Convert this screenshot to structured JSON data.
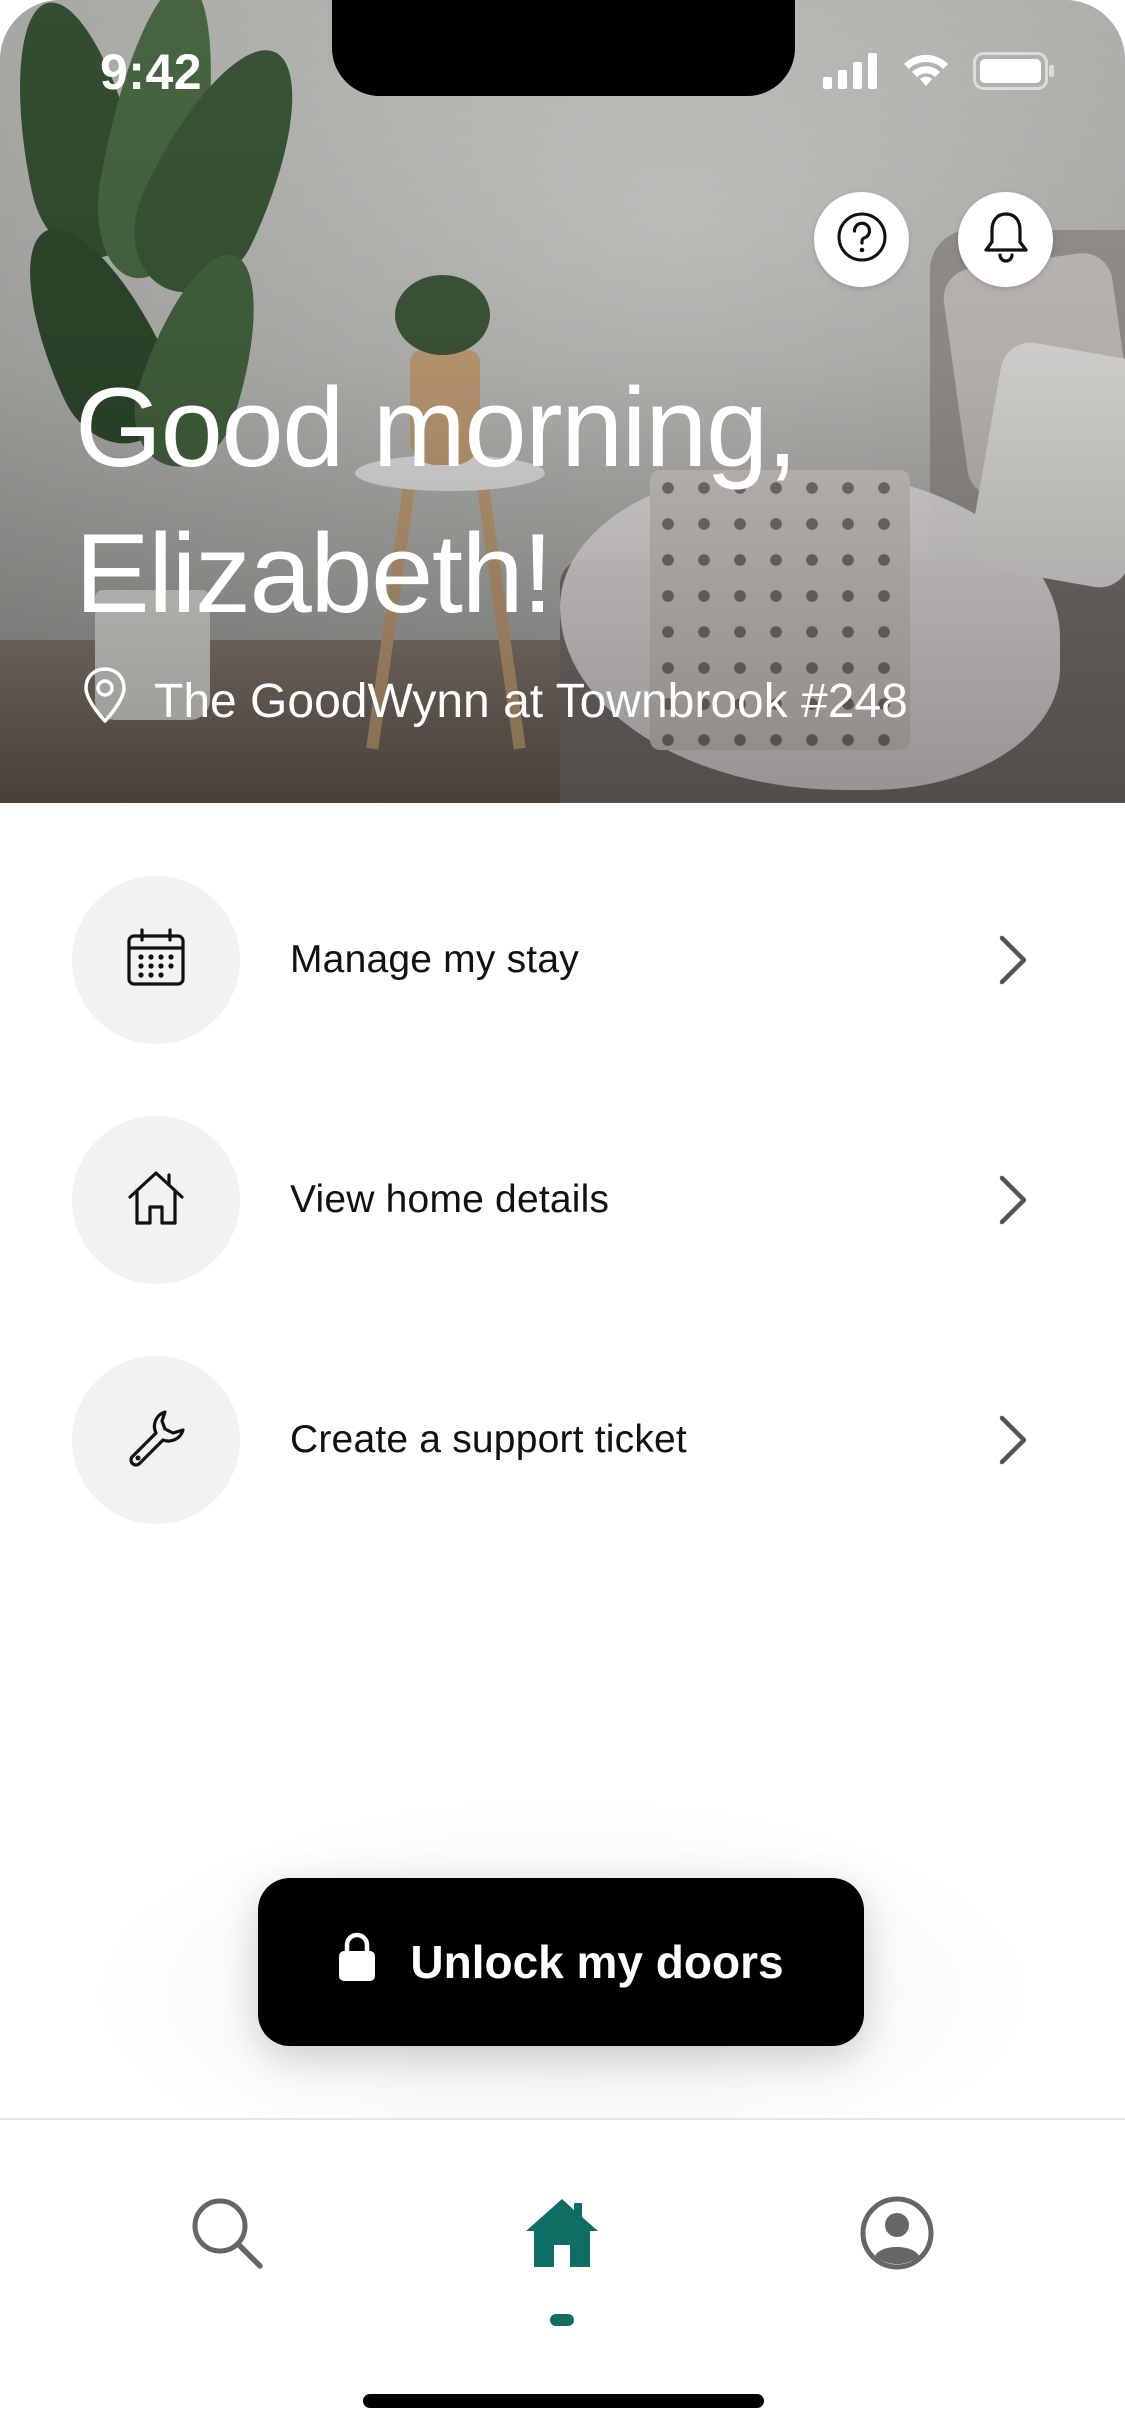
{
  "status_bar": {
    "time": "9:42"
  },
  "header": {
    "greeting_line1": "Good morning,",
    "greeting_line2": "Elizabeth!",
    "location": "The GoodWynn at Townbrook #248",
    "help_icon": "question-circle-icon",
    "notifications_icon": "bell-icon"
  },
  "menu": {
    "items": [
      {
        "label": "Manage my stay",
        "icon": "calendar-icon"
      },
      {
        "label": "View home details",
        "icon": "house-icon"
      },
      {
        "label": "Create a support ticket",
        "icon": "wrench-icon"
      }
    ]
  },
  "unlock": {
    "label": "Unlock my doors",
    "icon": "lock-icon"
  },
  "tabbar": {
    "tabs": [
      {
        "name": "search",
        "icon": "search-icon",
        "active": false
      },
      {
        "name": "home",
        "icon": "home-icon",
        "active": true
      },
      {
        "name": "profile",
        "icon": "account-icon",
        "active": false
      }
    ]
  },
  "colors": {
    "accent": "#0f6e63",
    "button_bg": "#000000",
    "icon_bg": "#f2f2f1"
  }
}
